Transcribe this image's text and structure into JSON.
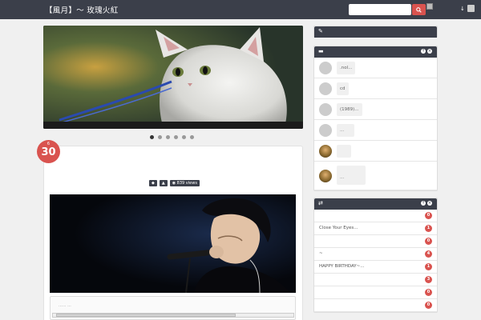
{
  "header": {
    "site_title": "【風月】～ 玫瑰火紅",
    "search_placeholder": ""
  },
  "icons": {
    "search": "search-icon",
    "pin": "pin-icon",
    "user": "user-icon",
    "comment": "comment-icon",
    "shuffle": "shuffle-icon",
    "pencil": "pencil-icon"
  },
  "colors": {
    "accent": "#d9534f",
    "dark": "#3b3f4a",
    "background": "#f0f0f0"
  },
  "slider": {
    "slide_count": 6,
    "active_index": 0
  },
  "post": {
    "date_month": "6",
    "date_day": "30",
    "views": "839 views",
    "embed_text": "......     ..."
  },
  "widgets": {
    "comments": {
      "items": [
        {
          "text": ".nol..."
        },
        {
          "text": "cd"
        },
        {
          "text": "(1989)..."
        },
        {
          "text": "..."
        },
        {
          "text": ""
        },
        {
          "text": "..."
        }
      ]
    },
    "random_posts": {
      "items": [
        {
          "title": "",
          "count": "0"
        },
        {
          "title": "Close Your Eyes...",
          "count": "1"
        },
        {
          "title": "",
          "count": "0"
        },
        {
          "title": "~",
          "count": "4"
        },
        {
          "title": "HAPPY BIRTHDAY~...",
          "count": "1"
        },
        {
          "title": "",
          "count": "3"
        },
        {
          "title": "",
          "count": "0"
        },
        {
          "title": "",
          "count": "0"
        }
      ]
    }
  }
}
